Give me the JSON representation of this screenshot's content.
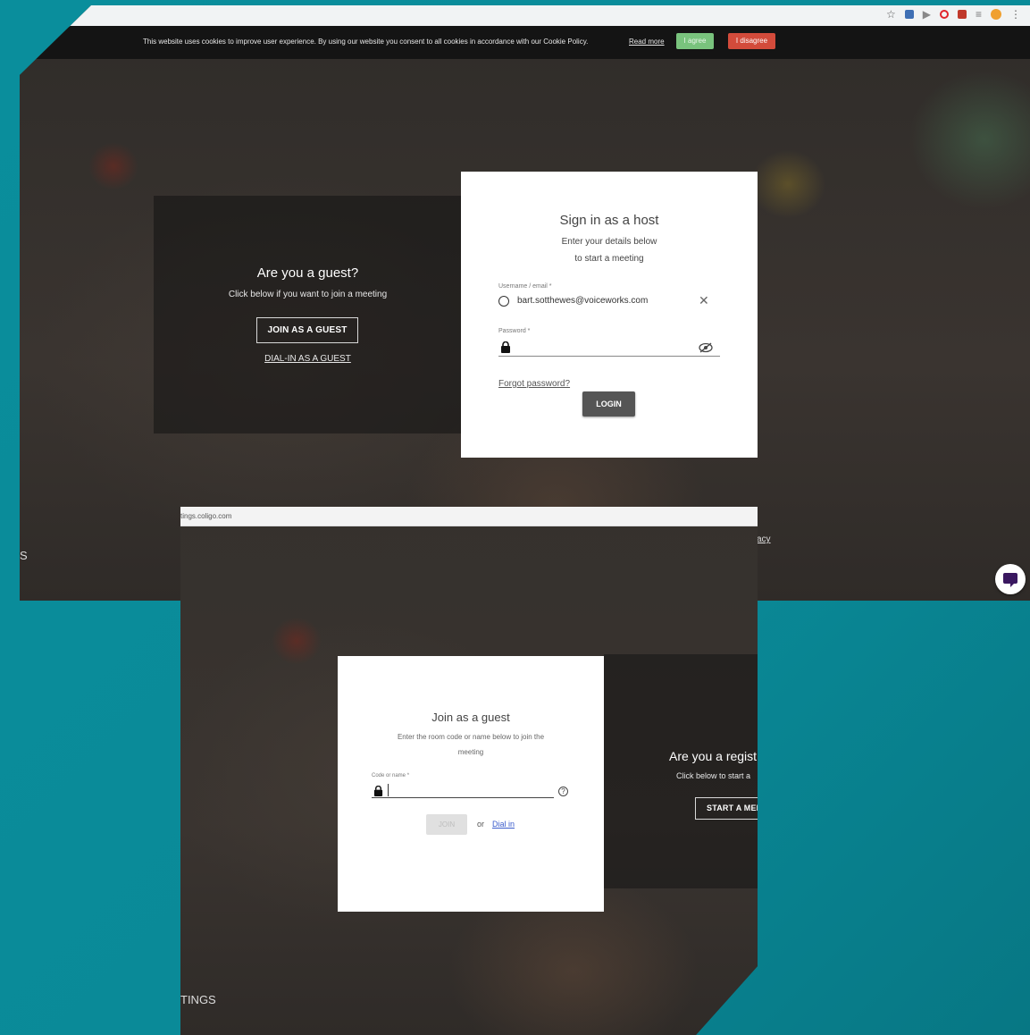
{
  "window1": {
    "browser_icons": [
      "star-icon",
      "extension-icon",
      "play-icon",
      "opera-icon",
      "extension-icon",
      "playlist-icon",
      "profile-icon",
      "menu-icon"
    ],
    "cookie_bar": {
      "text": "This website uses cookies to improve user experience. By using our website you consent to all cookies in accordance with our Cookie Policy.",
      "read_more": "Read more",
      "agree": "I agree",
      "disagree": "I disagree"
    },
    "guest": {
      "title": "Are you a guest?",
      "subtitle": "Click below if you want to join a meeting",
      "join_button": "JOIN AS A GUEST",
      "dialin_link": "DIAL-IN AS A GUEST"
    },
    "signin": {
      "title": "Sign in as a host",
      "subtitle_line1": "Enter your details below",
      "subtitle_line2": "to start a meeting",
      "username_label": "Username / email *",
      "username_value": "bart.sotthewes@voiceworks.com",
      "password_label": "Password *",
      "forgot": "Forgot password?",
      "login": "LOGIN"
    },
    "footer_left": "S",
    "footer_right": "acy"
  },
  "window2": {
    "url": "tings.coligo.com",
    "join": {
      "title": "Join as a guest",
      "subtitle_line1": "Enter the room code or name below to join the",
      "subtitle_line2": "meeting",
      "code_label": "Code or name *",
      "join_button": "JOIN",
      "or": "or",
      "dial_in": "Dial in"
    },
    "registered": {
      "title": "Are you a regist",
      "subtitle": "Click below to start a",
      "button": "START A MEE"
    },
    "footer_left": "TINGS"
  }
}
